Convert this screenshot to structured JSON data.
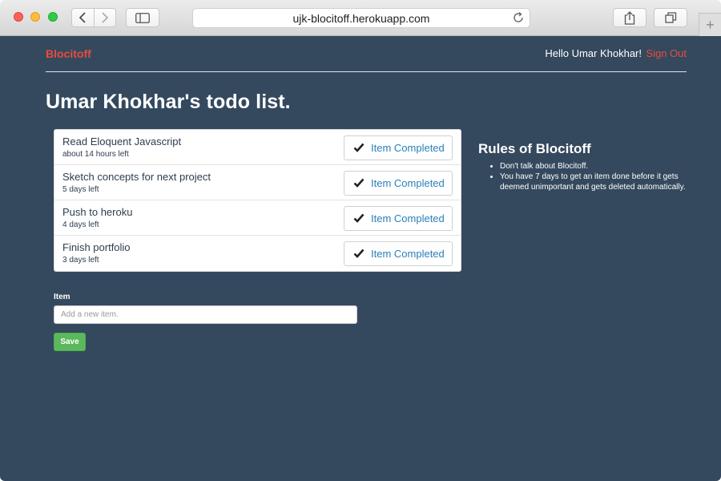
{
  "browser": {
    "url": "ujk-blocitoff.herokuapp.com"
  },
  "header": {
    "brand": "Blocitoff",
    "greeting": "Hello Umar Khokhar!",
    "sign_out": "Sign Out"
  },
  "page_title": "Umar Khokhar's todo list.",
  "todos": [
    {
      "name": "Read Eloquent Javascript",
      "due": "about 14 hours left",
      "action": "Item Completed"
    },
    {
      "name": "Sketch concepts for next project",
      "due": "5 days left",
      "action": "Item Completed"
    },
    {
      "name": "Push to heroku",
      "due": "4 days left",
      "action": "Item Completed"
    },
    {
      "name": "Finish portfolio",
      "due": "3 days left",
      "action": "Item Completed"
    }
  ],
  "rules": {
    "title": "Rules of Blocitoff",
    "items": [
      "Don't talk about Blocitoff.",
      "You have 7 days to get an item done before it gets deemed unimportant and gets deleted automatically."
    ]
  },
  "form": {
    "label": "Item",
    "placeholder": "Add a new item.",
    "value": "",
    "save_label": "Save"
  },
  "colors": {
    "background": "#34495e",
    "brand": "#e74c3c",
    "link": "#2980b9",
    "save": "#5cb85c"
  },
  "icons": {
    "back": "chevron-left-icon",
    "forward": "chevron-right-icon",
    "sidebar": "sidebar-icon",
    "reload": "reload-icon",
    "share": "share-icon",
    "tabs": "tabs-icon",
    "new_tab": "plus-icon",
    "done": "checkmark-icon"
  }
}
